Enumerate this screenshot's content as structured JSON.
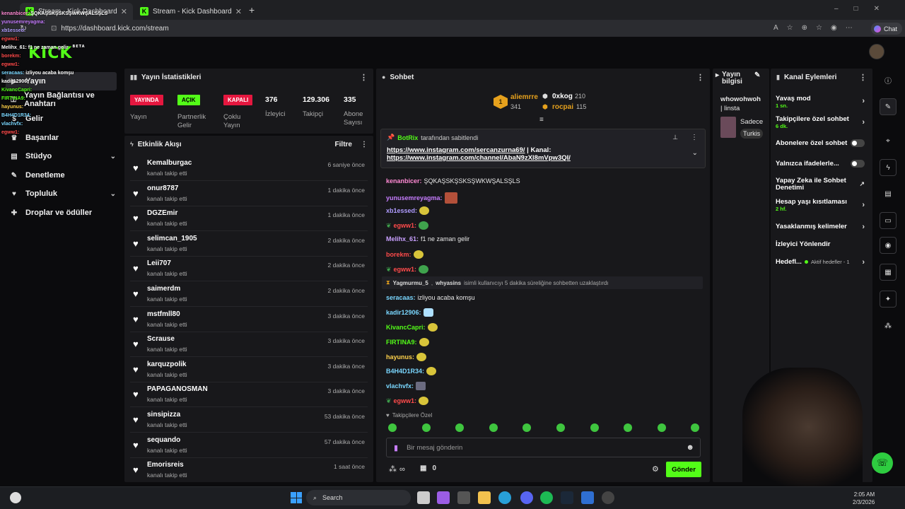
{
  "browser": {
    "tabs": [
      {
        "title": "Stream - Kick Dashboard"
      },
      {
        "title": "Stream - Kick Dashboard"
      }
    ],
    "url": "https://dashboard.kick.com/stream",
    "chat_button": "Chat"
  },
  "site": {
    "logo": "KICK",
    "logo_badge": "BETA"
  },
  "sidebar": {
    "items": [
      {
        "label": "Yayın"
      },
      {
        "label": "Yayın Bağlantısı ve Anahtarı"
      },
      {
        "label": "Gelir"
      },
      {
        "label": "Başarılar"
      },
      {
        "label": "Stüdyo"
      },
      {
        "label": "Denetleme"
      },
      {
        "label": "Topluluk"
      },
      {
        "label": "Droplar ve ödüller"
      }
    ]
  },
  "overlay_chat": [
    {
      "user": "kenanbicer",
      "text": "ŞQKAŞSKŞSKSŞWKWŞALSŞLS",
      "color": "#ff8ad4"
    },
    {
      "user": "yunusemreyagma",
      "text": "",
      "color": "#c77dff"
    },
    {
      "user": "xb1essed",
      "text": "",
      "color": "#b09cff"
    },
    {
      "user": "egww1",
      "text": "",
      "color": "#ff4b4b"
    },
    {
      "user": "Melihx_61",
      "text": "f1 ne zaman gelir",
      "color": "#fff"
    },
    {
      "user": "borekm",
      "text": "",
      "color": "#ff4b4b"
    },
    {
      "user": "egww1",
      "text": "",
      "color": "#ff4b4b"
    },
    {
      "user": "seracaas",
      "text": "izliyou acaba komşu",
      "color": "#7ad7ff"
    },
    {
      "user": "kadir12906",
      "text": "",
      "color": "#fff"
    },
    {
      "user": "KivancCapri",
      "text": "",
      "color": "#53fc18"
    },
    {
      "user": "FIRTINA9",
      "text": "",
      "color": "#53fc18"
    },
    {
      "user": "hayunus",
      "text": "",
      "color": "#ffd24b"
    },
    {
      "user": "B4H4D1R34",
      "text": "",
      "color": "#7ad7ff"
    },
    {
      "user": "vlachvfx",
      "text": "",
      "color": "#7ad7ff"
    },
    {
      "user": "egww1",
      "text": "",
      "color": "#ff4b4b"
    }
  ],
  "stats": {
    "title": "Yayın İstatistikleri",
    "badges": [
      {
        "text": "YAYINDA",
        "label": "Yayın",
        "color": "#e5173f"
      },
      {
        "text": "AÇIK",
        "label": "Partnerlik Gelir",
        "color": "#53fc18"
      },
      {
        "text": "KAPALI",
        "label": "Çoklu Yayın",
        "color": "#e5173f"
      }
    ],
    "numbers": [
      {
        "value": "376",
        "label": "İzleyici"
      },
      {
        "value": "129.306",
        "label": "Takipçi"
      },
      {
        "value": "335",
        "label": "Abone Sayısı"
      }
    ]
  },
  "activity": {
    "title": "Etkinlik Akışı",
    "filter": "Filtre",
    "items": [
      {
        "name": "Kemalburgac",
        "sub": "kanalı takip etti",
        "time": "6 saniye önce"
      },
      {
        "name": "onur8787",
        "sub": "kanalı takip etti",
        "time": "1 dakika önce"
      },
      {
        "name": "DGZEmir",
        "sub": "kanalı takip etti",
        "time": "1 dakika önce"
      },
      {
        "name": "selimcan_1905",
        "sub": "kanalı takip etti",
        "time": "2 dakika önce"
      },
      {
        "name": "Leii707",
        "sub": "kanalı takip etti",
        "time": "2 dakika önce"
      },
      {
        "name": "saimerdm",
        "sub": "kanalı takip etti",
        "time": "2 dakika önce"
      },
      {
        "name": "mstfmll80",
        "sub": "kanalı takip etti",
        "time": "3 dakika önce"
      },
      {
        "name": "Scrause",
        "sub": "kanalı takip etti",
        "time": "3 dakika önce"
      },
      {
        "name": "karquzpolik",
        "sub": "kanalı takip etti",
        "time": "3 dakika önce"
      },
      {
        "name": "PAPAGANOSMAN",
        "sub": "kanalı takip etti",
        "time": "3 dakika önce"
      },
      {
        "name": "sinsipizza",
        "sub": "kanalı takip etti",
        "time": "53 dakika önce"
      },
      {
        "name": "sequando",
        "sub": "kanalı takip etti",
        "time": "57 dakika önce"
      },
      {
        "name": "Emorisreis",
        "sub": "kanalı takip etti",
        "time": "1 saat önce"
      }
    ]
  },
  "chat": {
    "title": "Sohbet",
    "leaderboard": [
      {
        "rank": "1",
        "name": "aliemrre",
        "count": "341"
      },
      {
        "name": "0xkog",
        "count": "210"
      },
      {
        "name": "rocpai",
        "count": "115"
      }
    ],
    "pinned": {
      "by": "BotRix",
      "by_suffix": "tarafından sabitlendi",
      "line1": "https://www.instagram.com/sercanzurna69/",
      "sep": " | Kanal:",
      "line2": "https://www.instagram.com/channel/AbaN9zXl8mVpw3QI/"
    },
    "messages": [
      {
        "user": "kenanbicer",
        "text": "ŞQKAŞSKŞSKSŞWKWŞALSŞLS",
        "color": "#ff8ad4",
        "emote": ""
      },
      {
        "user": "yunusemreyagma",
        "text": "",
        "color": "#c77dff",
        "emote": "r"
      },
      {
        "user": "xb1essed",
        "text": "",
        "color": "#b09cff",
        "emote": "y"
      },
      {
        "user": "egww1",
        "text": "",
        "color": "#ff4b4b",
        "emote": "g"
      },
      {
        "user": "Melihx_61",
        "text": "f1 ne zaman gelir",
        "color": "#c9a0ff",
        "emote": ""
      },
      {
        "user": "borekm",
        "text": "",
        "color": "#ff4b4b",
        "emote": "y"
      },
      {
        "user": "egww1",
        "text": "",
        "color": "#ff4b4b",
        "emote": "g"
      },
      {
        "user": "seracaas",
        "text": "izliyou acaba komşu",
        "color": "#7ad7ff",
        "emote": ""
      },
      {
        "user": "kadir12906",
        "text": "",
        "color": "#7ad7ff",
        "emote": "b"
      },
      {
        "user": "KivancCapri",
        "text": "",
        "color": "#53fc18",
        "emote": "y"
      },
      {
        "user": "FIRTINA9",
        "text": "",
        "color": "#53fc18",
        "emote": "y"
      },
      {
        "user": "hayunus",
        "text": "",
        "color": "#ffd24b",
        "emote": "y"
      },
      {
        "user": "B4H4D1R34",
        "text": "",
        "color": "#7ad7ff",
        "emote": "y"
      },
      {
        "user": "vlachvfx",
        "text": "",
        "color": "#7ad7ff",
        "emote": "p"
      },
      {
        "user": "egww1",
        "text": "",
        "color": "#ff4b4b",
        "emote": "y"
      }
    ],
    "timeout": {
      "mod": "Yagmurmu_5",
      "target": "whyasins",
      "text": "isimli kullanıcıyı 5 dakika süreliğine sohbetten uzaklaştırdı"
    },
    "followers_only": "Takipçilere Özel",
    "input_placeholder": "Bir mesaj gönderin",
    "infinity": "∞",
    "gift_count": "0",
    "send": "Gönder"
  },
  "stream_info": {
    "title": "Yayın bilgisi",
    "text1": "whowohwoh",
    "text2": "| linsta",
    "category": "Sadece",
    "tag": "Turkis"
  },
  "channel_actions": {
    "title": "Kanal Eylemleri",
    "items": [
      {
        "label": "Yavaş mod",
        "sub": "1 sn."
      },
      {
        "label": "Takipçilere özel sohbet",
        "sub": "6 dk."
      },
      {
        "label": "Abonelere özel sohbet",
        "sub": ""
      },
      {
        "label": "Yalnızca ifadelerle...",
        "sub": ""
      },
      {
        "label": "Yapay Zeka ile Sohbet Denetimi",
        "sub": ""
      },
      {
        "label": "Hesap yaşı kısıtlaması",
        "sub": "2 hf."
      },
      {
        "label": "Yasaklanmış kelimeler",
        "sub": ""
      },
      {
        "label": "İzleyici Yönlendir",
        "sub": ""
      },
      {
        "label": "Hedefl...",
        "sub": "Aktif hedefler - 1"
      }
    ]
  },
  "taskbar": {
    "search": "Search",
    "time": "2:05 AM",
    "date": "2/3/2026"
  }
}
